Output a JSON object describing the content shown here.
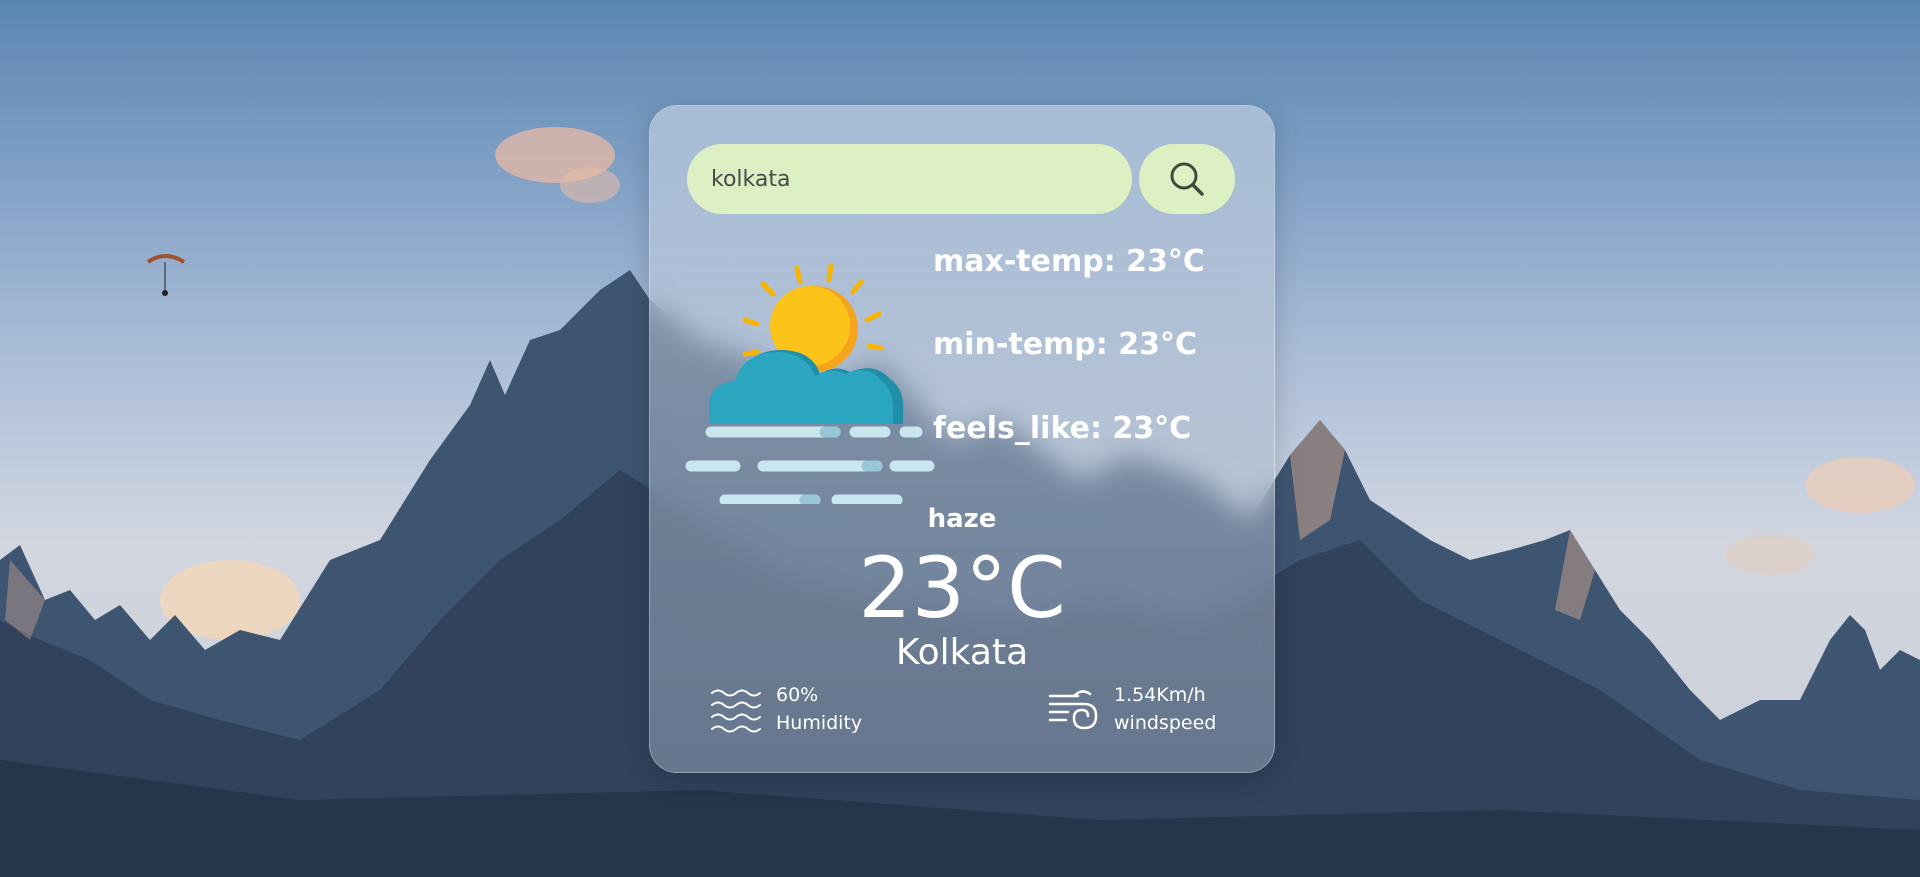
{
  "search": {
    "value": "kolkata",
    "placeholder": ""
  },
  "weather": {
    "max_temp": "max-temp: 23°C",
    "min_temp": "min-temp: 23°C",
    "feels_like": "feels_like: 23°C",
    "condition": "haze",
    "temperature": "23°C",
    "city": "Kolkata",
    "humidity_value": "60%",
    "humidity_label": "Humidity",
    "wind_value": "1.54Km/h",
    "wind_label": "windspeed"
  },
  "icons": {
    "search": "search-icon",
    "weather": "sun-cloud-haze-icon",
    "humidity": "humidity-waves-icon",
    "wind": "wind-icon"
  },
  "colors": {
    "input_bg": "#dcf0c4",
    "text": "#ffffff",
    "sun": "#fbbf24",
    "cloud": "#2aa6c0"
  }
}
